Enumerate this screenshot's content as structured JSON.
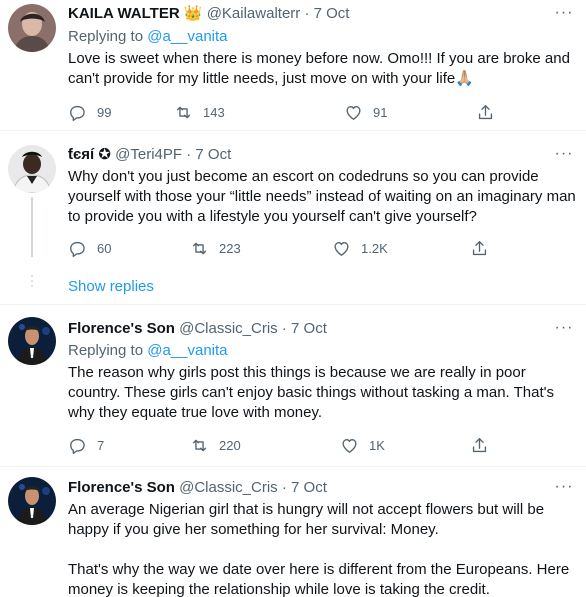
{
  "tweets": [
    {
      "name": "KAILA WALTER",
      "badge": "👑",
      "handle": "@Kailawalterr",
      "dot": "·",
      "date": "7 Oct",
      "replying_prefix": "Replying to",
      "replying_to": "@a__vanita",
      "text": "Love is sweet when there is money before now. Omo!!! If you are broke and can't provide for my little needs, just move on with your life🙏🏼",
      "replies": "99",
      "retweets": "143",
      "likes": "91"
    },
    {
      "name": "ƭєяí",
      "badge": "✪",
      "handle": "@Teri4PF",
      "dot": "·",
      "date": "7 Oct",
      "text": "Why don't you just become an escort on codedruns so you can provide yourself with those your “little needs” instead of waiting on an imaginary man to provide you with a lifestyle you yourself can't give yourself?",
      "replies": "60",
      "retweets": "223",
      "likes": "1.2K"
    },
    {
      "name": "Florence's Son",
      "handle": "@Classic_Cris",
      "dot": "·",
      "date": "7 Oct",
      "replying_prefix": "Replying to",
      "replying_to": "@a__vanita",
      "text": "The reason why girls post this things is because we are really in poor country. These girls can't enjoy basic things without tasking a man. That's why they equate true love with money.",
      "replies": "7",
      "retweets": "220",
      "likes": "1K"
    },
    {
      "name": "Florence's Son",
      "handle": "@Classic_Cris",
      "dot": "·",
      "date": "7 Oct",
      "text_p1": "An average Nigerian girl that is hungry will not accept flowers but will be happy if you give her something for her survival: Money.",
      "text_p2": "That's why the way we date over here is different from the Europeans. Here money is keeping the relationship while love is taking the credit."
    }
  ],
  "show_replies": "Show replies",
  "more_glyph": "···",
  "icons": {
    "reply": "reply-icon",
    "retweet": "retweet-icon",
    "like": "heart-icon",
    "share": "share-icon",
    "more": "more-icon"
  },
  "colors": {
    "link": "#1d9bf0",
    "secondary": "#536471",
    "text": "#0f1419"
  }
}
